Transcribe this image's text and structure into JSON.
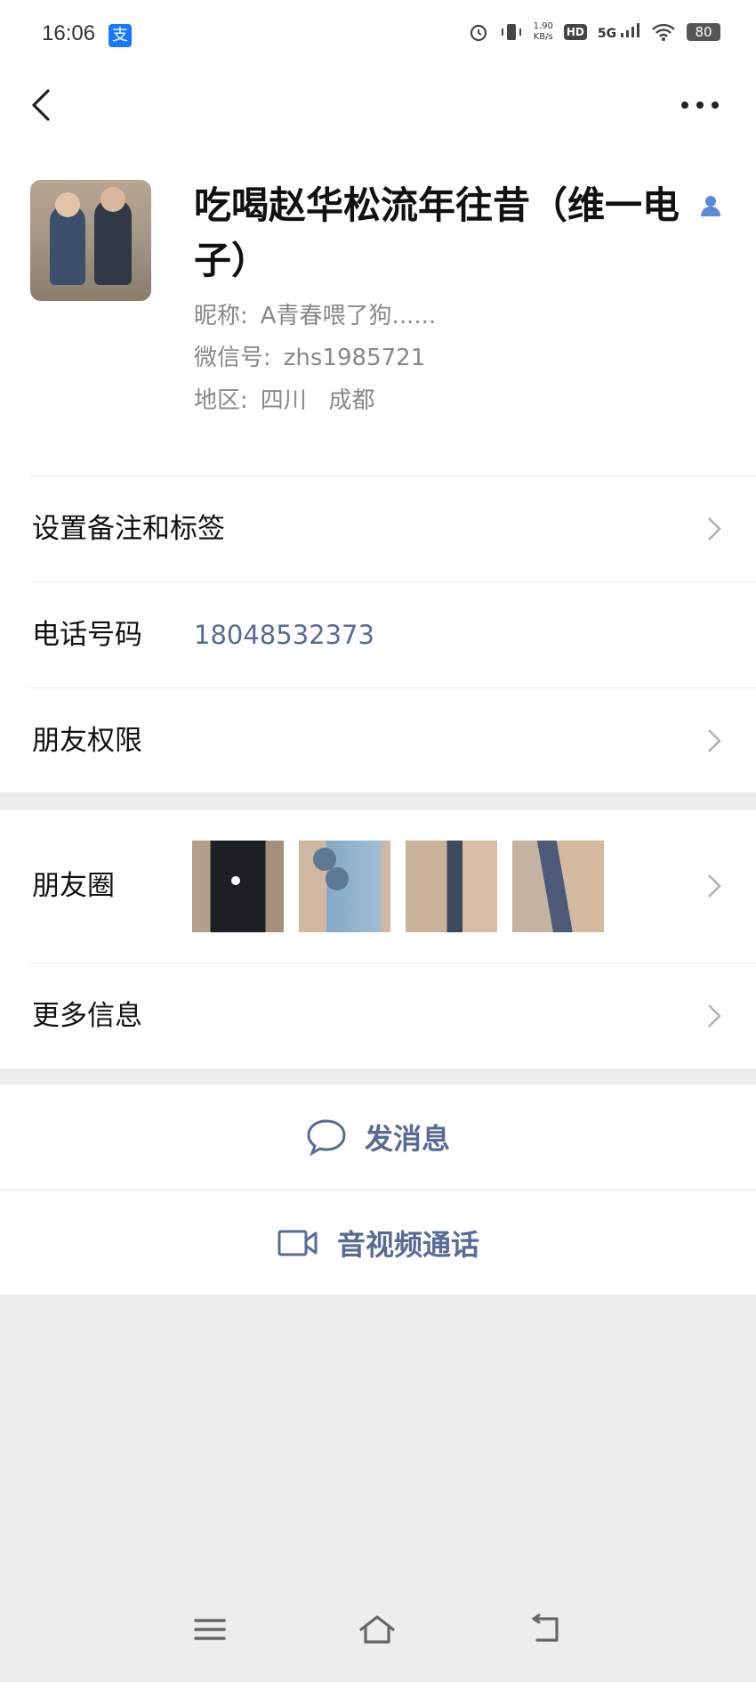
{
  "status_bar": {
    "time": "16:06",
    "app_badge": "支",
    "net_speed_top": "1.90",
    "net_speed_bottom": "KB/s",
    "hd_label": "HD",
    "network": "5G",
    "battery": "80",
    "icons": [
      "alarm-icon",
      "vibrate-icon",
      "hd-icon",
      "signal-icon",
      "wifi-icon",
      "battery-icon"
    ]
  },
  "header": {
    "back_icon": "back-chevron-icon",
    "more_icon": "more-dots-icon"
  },
  "profile": {
    "name": "吃喝赵华松流年往昔（维一电子）",
    "nickname_label": "昵称:",
    "nickname": "A青春喂了狗......",
    "wechat_id_label": "微信号:",
    "wechat_id": "zhs1985721",
    "region_label": "地区:",
    "region": "四川   成都"
  },
  "rows": {
    "remark_label": "设置备注和标签",
    "phone_label": "电话号码",
    "phone_value": "18048532373",
    "permission_label": "朋友权限",
    "moments_label": "朋友圈",
    "more_info_label": "更多信息"
  },
  "actions": {
    "message_label": "发消息",
    "call_label": "音视频通话"
  },
  "colors": {
    "link": "#576b95",
    "background": "#ededed"
  }
}
